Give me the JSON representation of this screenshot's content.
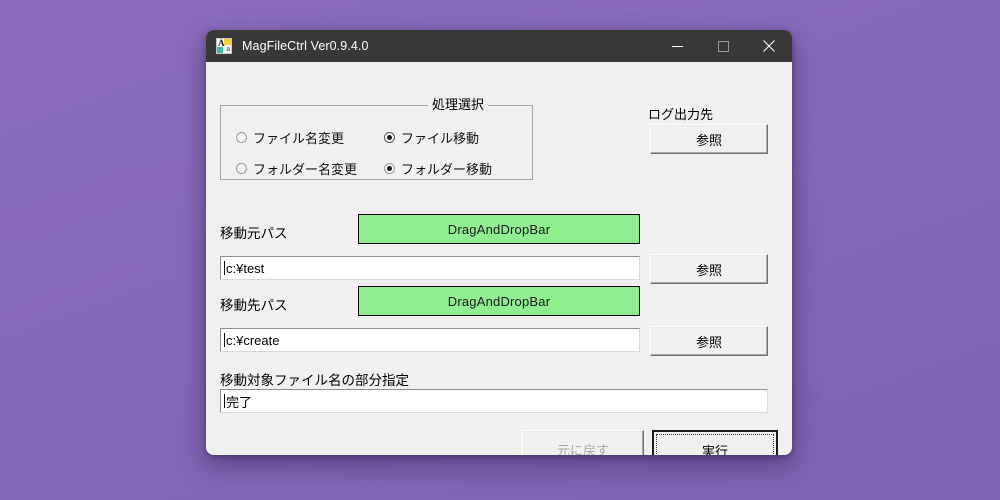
{
  "desktop": {
    "background_color": "#8668b8"
  },
  "window": {
    "title": "MagFileCtrl Ver0.9.4.0",
    "icon": "app-rename-icon",
    "titlebar_color": "#393939",
    "body_color": "#f0f0f0",
    "controls": {
      "minimize": "minimize-icon",
      "maximize": "maximize-icon",
      "close": "close-icon"
    }
  },
  "process_group": {
    "legend": "処理選択",
    "options": [
      {
        "label": "ファイル名変更",
        "checked": false
      },
      {
        "label": "ファイル移動",
        "checked": true
      },
      {
        "label": "フォルダー名変更",
        "checked": false
      },
      {
        "label": "フォルダー移動",
        "checked": false
      }
    ]
  },
  "log": {
    "label": "ログ出力先",
    "browse_label": "参照"
  },
  "source": {
    "label": "移動元パス",
    "dnd_label": "DragAndDropBar",
    "dnd_color": "#90ee90",
    "value": "c:¥test",
    "browse_label": "参照"
  },
  "destination": {
    "label": "移動先パス",
    "dnd_label": "DragAndDropBar",
    "dnd_color": "#90ee90",
    "value": "c:¥create",
    "browse_label": "参照"
  },
  "filter": {
    "label": "移動対象ファイル名の部分指定",
    "value": "完了"
  },
  "actions": {
    "undo_label": "元に戻す",
    "undo_enabled": false,
    "execute_label": "実行",
    "execute_focused": true
  }
}
